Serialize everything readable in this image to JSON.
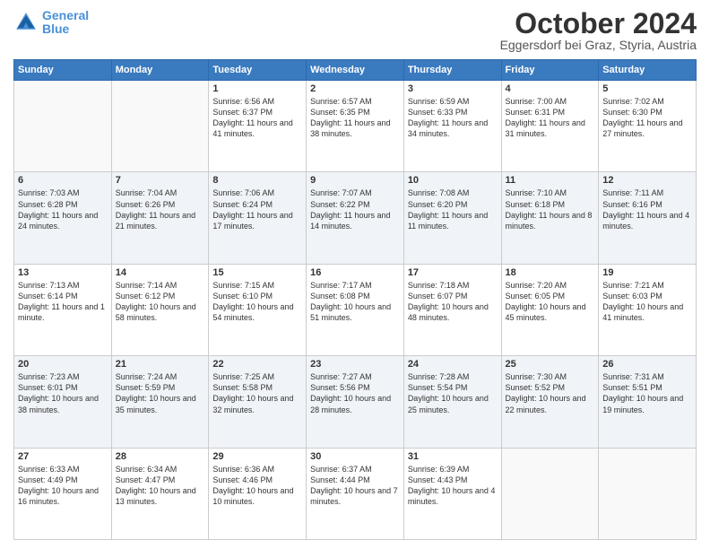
{
  "header": {
    "logo_line1": "General",
    "logo_line2": "Blue",
    "month_title": "October 2024",
    "subtitle": "Eggersdorf bei Graz, Styria, Austria"
  },
  "weekdays": [
    "Sunday",
    "Monday",
    "Tuesday",
    "Wednesday",
    "Thursday",
    "Friday",
    "Saturday"
  ],
  "weeks": [
    [
      {
        "day": "",
        "info": ""
      },
      {
        "day": "",
        "info": ""
      },
      {
        "day": "1",
        "info": "Sunrise: 6:56 AM\nSunset: 6:37 PM\nDaylight: 11 hours and 41 minutes."
      },
      {
        "day": "2",
        "info": "Sunrise: 6:57 AM\nSunset: 6:35 PM\nDaylight: 11 hours and 38 minutes."
      },
      {
        "day": "3",
        "info": "Sunrise: 6:59 AM\nSunset: 6:33 PM\nDaylight: 11 hours and 34 minutes."
      },
      {
        "day": "4",
        "info": "Sunrise: 7:00 AM\nSunset: 6:31 PM\nDaylight: 11 hours and 31 minutes."
      },
      {
        "day": "5",
        "info": "Sunrise: 7:02 AM\nSunset: 6:30 PM\nDaylight: 11 hours and 27 minutes."
      }
    ],
    [
      {
        "day": "6",
        "info": "Sunrise: 7:03 AM\nSunset: 6:28 PM\nDaylight: 11 hours and 24 minutes."
      },
      {
        "day": "7",
        "info": "Sunrise: 7:04 AM\nSunset: 6:26 PM\nDaylight: 11 hours and 21 minutes."
      },
      {
        "day": "8",
        "info": "Sunrise: 7:06 AM\nSunset: 6:24 PM\nDaylight: 11 hours and 17 minutes."
      },
      {
        "day": "9",
        "info": "Sunrise: 7:07 AM\nSunset: 6:22 PM\nDaylight: 11 hours and 14 minutes."
      },
      {
        "day": "10",
        "info": "Sunrise: 7:08 AM\nSunset: 6:20 PM\nDaylight: 11 hours and 11 minutes."
      },
      {
        "day": "11",
        "info": "Sunrise: 7:10 AM\nSunset: 6:18 PM\nDaylight: 11 hours and 8 minutes."
      },
      {
        "day": "12",
        "info": "Sunrise: 7:11 AM\nSunset: 6:16 PM\nDaylight: 11 hours and 4 minutes."
      }
    ],
    [
      {
        "day": "13",
        "info": "Sunrise: 7:13 AM\nSunset: 6:14 PM\nDaylight: 11 hours and 1 minute."
      },
      {
        "day": "14",
        "info": "Sunrise: 7:14 AM\nSunset: 6:12 PM\nDaylight: 10 hours and 58 minutes."
      },
      {
        "day": "15",
        "info": "Sunrise: 7:15 AM\nSunset: 6:10 PM\nDaylight: 10 hours and 54 minutes."
      },
      {
        "day": "16",
        "info": "Sunrise: 7:17 AM\nSunset: 6:08 PM\nDaylight: 10 hours and 51 minutes."
      },
      {
        "day": "17",
        "info": "Sunrise: 7:18 AM\nSunset: 6:07 PM\nDaylight: 10 hours and 48 minutes."
      },
      {
        "day": "18",
        "info": "Sunrise: 7:20 AM\nSunset: 6:05 PM\nDaylight: 10 hours and 45 minutes."
      },
      {
        "day": "19",
        "info": "Sunrise: 7:21 AM\nSunset: 6:03 PM\nDaylight: 10 hours and 41 minutes."
      }
    ],
    [
      {
        "day": "20",
        "info": "Sunrise: 7:23 AM\nSunset: 6:01 PM\nDaylight: 10 hours and 38 minutes."
      },
      {
        "day": "21",
        "info": "Sunrise: 7:24 AM\nSunset: 5:59 PM\nDaylight: 10 hours and 35 minutes."
      },
      {
        "day": "22",
        "info": "Sunrise: 7:25 AM\nSunset: 5:58 PM\nDaylight: 10 hours and 32 minutes."
      },
      {
        "day": "23",
        "info": "Sunrise: 7:27 AM\nSunset: 5:56 PM\nDaylight: 10 hours and 28 minutes."
      },
      {
        "day": "24",
        "info": "Sunrise: 7:28 AM\nSunset: 5:54 PM\nDaylight: 10 hours and 25 minutes."
      },
      {
        "day": "25",
        "info": "Sunrise: 7:30 AM\nSunset: 5:52 PM\nDaylight: 10 hours and 22 minutes."
      },
      {
        "day": "26",
        "info": "Sunrise: 7:31 AM\nSunset: 5:51 PM\nDaylight: 10 hours and 19 minutes."
      }
    ],
    [
      {
        "day": "27",
        "info": "Sunrise: 6:33 AM\nSunset: 4:49 PM\nDaylight: 10 hours and 16 minutes."
      },
      {
        "day": "28",
        "info": "Sunrise: 6:34 AM\nSunset: 4:47 PM\nDaylight: 10 hours and 13 minutes."
      },
      {
        "day": "29",
        "info": "Sunrise: 6:36 AM\nSunset: 4:46 PM\nDaylight: 10 hours and 10 minutes."
      },
      {
        "day": "30",
        "info": "Sunrise: 6:37 AM\nSunset: 4:44 PM\nDaylight: 10 hours and 7 minutes."
      },
      {
        "day": "31",
        "info": "Sunrise: 6:39 AM\nSunset: 4:43 PM\nDaylight: 10 hours and 4 minutes."
      },
      {
        "day": "",
        "info": ""
      },
      {
        "day": "",
        "info": ""
      }
    ]
  ]
}
